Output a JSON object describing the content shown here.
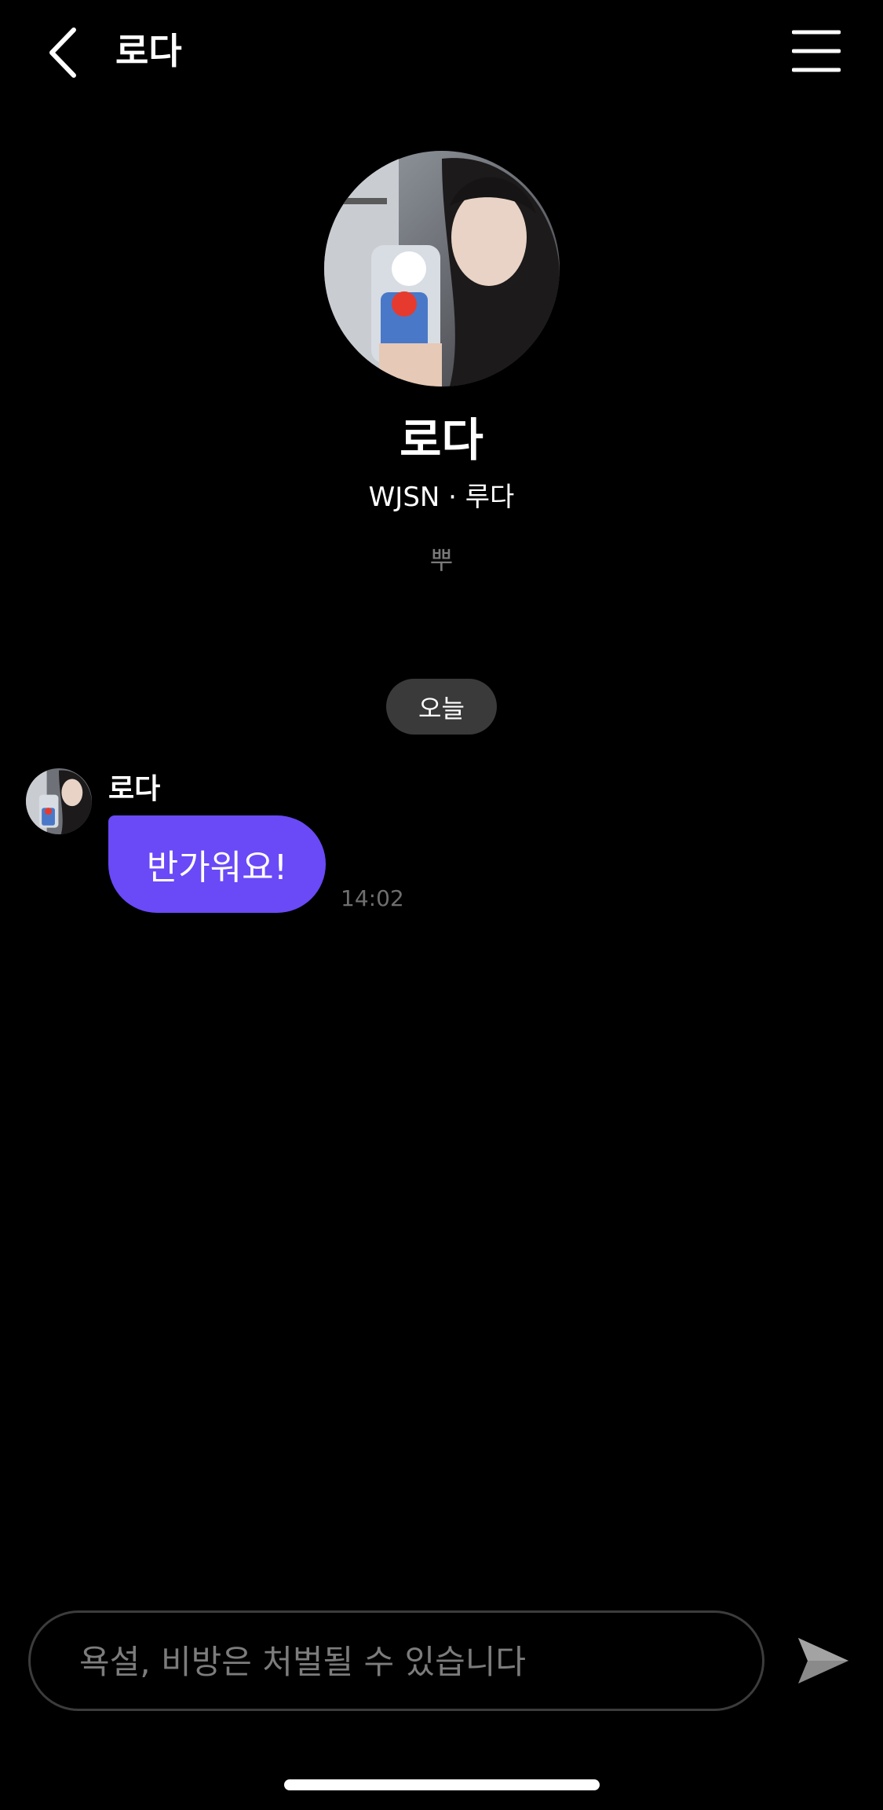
{
  "header": {
    "title": "로다",
    "back_icon": "chevron-left-icon",
    "menu_icon": "hamburger-menu-icon"
  },
  "profile": {
    "name": "로다",
    "subtitle": "WJSN · 루다",
    "status": "뿌"
  },
  "chat": {
    "date_divider": "오늘",
    "messages": [
      {
        "sender": "로다",
        "text": "반가워요!",
        "time": "14:02"
      }
    ]
  },
  "composer": {
    "placeholder": "욕설, 비방은 처벌될 수 있습니다",
    "value": "",
    "send_icon": "send-arrow-icon"
  },
  "colors": {
    "background": "#000000",
    "bubble": "#6a49f7",
    "date_pill": "#3a3a3a",
    "muted_text": "#7a7a7a"
  }
}
